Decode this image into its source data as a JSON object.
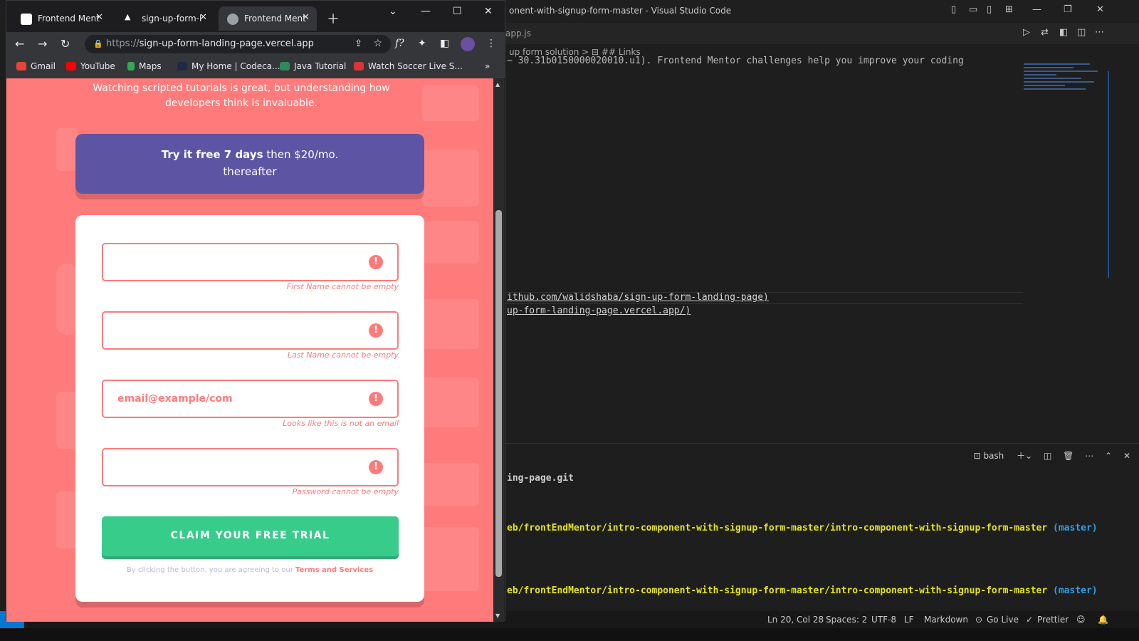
{
  "vscode": {
    "title": "onent-with-signup-form-master - Visual Studio Code",
    "tab": "app.js",
    "breadcrumb": "up form solution > ⊟ ## Links",
    "code_top": "~ 30.31b0150000020010.u1). Frontend Mentor challenges help you improve your coding",
    "code_line1": "ithub.com/walidshaba/sign-up-form-landing-page)",
    "code_line2": "up-form-landing-page.vercel.app/)",
    "terminal_shell": "bash",
    "term_line1": "ing-page.git",
    "term_line2": "eb/frontEndMentor/intro-component-with-signup-form-master/intro-component-with-signup-form-master",
    "term_branch": "(master)",
    "term_line3": "eb/frontEndMentor/intro-component-with-signup-form-master/intro-component-with-signup-form-master",
    "status": {
      "position": "Ln 20, Col 28",
      "spaces": "Spaces: 2",
      "encoding": "UTF-8",
      "eol": "LF",
      "language": "Markdown",
      "golive": "Go Live",
      "prettier": "Prettier"
    }
  },
  "browser": {
    "tabs": [
      {
        "label": "Frontend Ment",
        "icon": "frontend-mentor-favicon"
      },
      {
        "label": "sign-up-form-l",
        "icon": "vercel-favicon"
      },
      {
        "label": "Frontend Ment",
        "icon": "globe-favicon"
      }
    ],
    "url_scheme": "https://",
    "url_host": "sign-up-form-landing-page.vercel.app",
    "bookmarks": [
      "Gmail",
      "YouTube",
      "Maps",
      "My Home | Codeca...",
      "Java Tutorial",
      "Watch Soccer Live S..."
    ]
  },
  "page": {
    "intro_line1": "Watching scripted tutorials is great, but understanding how",
    "intro_line2": "developers think is invaluable.",
    "promo_bold": "Try it free 7 days",
    "promo_rest": " then $20/mo.",
    "promo_line2": "thereafter",
    "fields": [
      {
        "value": "",
        "error": "First Name cannot be empty"
      },
      {
        "value": "",
        "error": "Last Name cannot be empty"
      },
      {
        "value": "email@example/com",
        "error": "Looks like this is not an email"
      },
      {
        "value": "",
        "error": "Password cannot be empty"
      }
    ],
    "error_glyph": "!",
    "cta": "CLAIM YOUR FREE TRIAL",
    "terms_prefix": "By clicking the button, you are agreeing to our ",
    "terms_link": "Terms and Services"
  },
  "colors": {
    "background": "#ff7a7a",
    "promo": "#5e54a4",
    "cta": "#38cc8b",
    "error": "#ff7a7a"
  }
}
